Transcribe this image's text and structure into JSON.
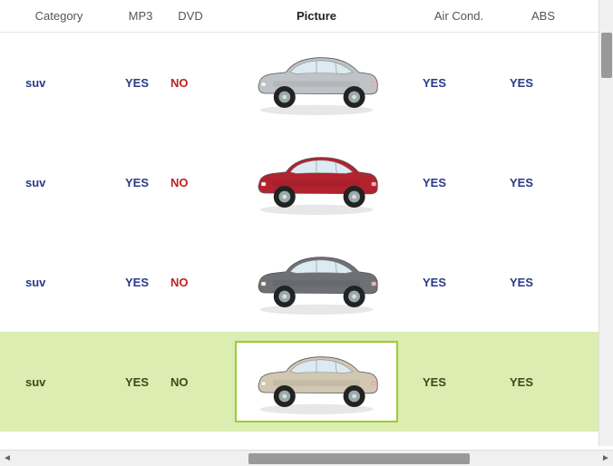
{
  "columns": {
    "category": "Category",
    "mp3": "MP3",
    "dvd": "DVD",
    "picture": "Picture",
    "aircond": "Air Cond.",
    "abs": "ABS"
  },
  "selected_column": "picture",
  "car_colors": [
    "#bfc3c7",
    "#b2222f",
    "#6d7176",
    "#d1c7b2"
  ],
  "rows": [
    {
      "category": "suv",
      "mp3": "YES",
      "dvd": "NO",
      "aircond": "YES",
      "abs": "YES",
      "selected": false
    },
    {
      "category": "suv",
      "mp3": "YES",
      "dvd": "NO",
      "aircond": "YES",
      "abs": "YES",
      "selected": false
    },
    {
      "category": "suv",
      "mp3": "YES",
      "dvd": "NO",
      "aircond": "YES",
      "abs": "YES",
      "selected": false
    },
    {
      "category": "suv",
      "mp3": "YES",
      "dvd": "NO",
      "aircond": "YES",
      "abs": "YES",
      "selected": true
    }
  ],
  "values": {
    "yes": "YES",
    "no": "NO"
  }
}
